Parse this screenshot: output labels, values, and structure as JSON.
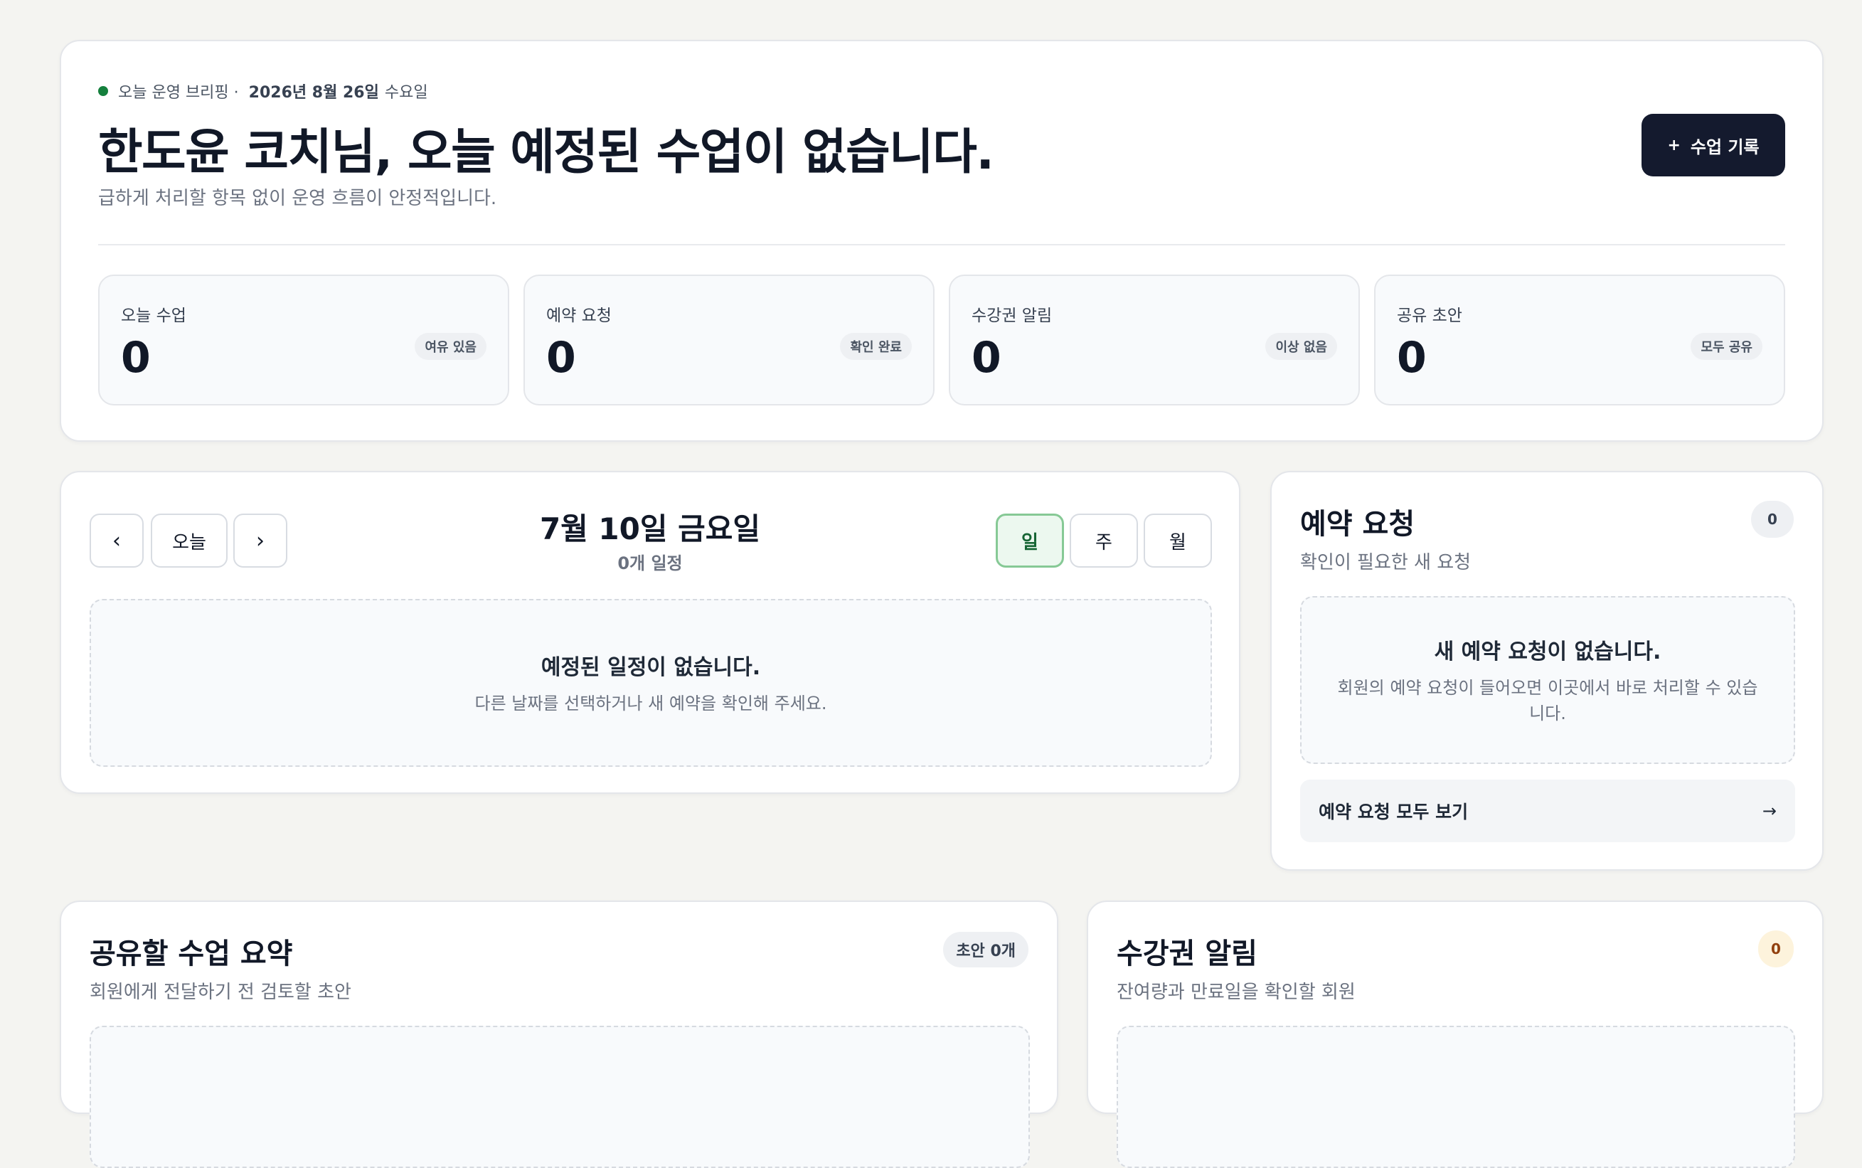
{
  "hero": {
    "eyebrow_label": "오늘 운영 브리핑 ·",
    "eyebrow_date": "2026년 8월 26일",
    "eyebrow_weekday": "수요일",
    "title": "한도윤 코치님, 오늘 예정된 수업이 없습니다.",
    "subtitle": "급하게 처리할 항목 없이 운영 흐름이 안정적입니다.",
    "primary_button": "수업 기록",
    "primary_button_icon": "+",
    "accent_color": "#15803d"
  },
  "stats": [
    {
      "label": "오늘 수업",
      "value": "0",
      "badge": "여유 있음"
    },
    {
      "label": "예약 요청",
      "value": "0",
      "badge": "확인 완료"
    },
    {
      "label": "수강권 알림",
      "value": "0",
      "badge": "이상 없음"
    },
    {
      "label": "공유 초안",
      "value": "0",
      "badge": "모두 공유"
    }
  ],
  "schedule": {
    "prev_label": "‹",
    "today_label": "오늘",
    "next_label": "›",
    "date_title": "7월 10일 금요일",
    "count_label": "0개 일정",
    "views": [
      {
        "label": "일",
        "active": true
      },
      {
        "label": "주",
        "active": false
      },
      {
        "label": "월",
        "active": false
      }
    ],
    "empty_title": "예정된 일정이 없습니다.",
    "empty_desc": "다른 날짜를 선택하거나 새 예약을 확인해 주세요."
  },
  "requests": {
    "title": "예약 요청",
    "subtitle": "확인이 필요한 새 요청",
    "count": "0",
    "empty_title": "새 예약 요청이 없습니다.",
    "empty_desc": "회원의 예약 요청이 들어오면 이곳에서 바로 처리할 수 있습니다.",
    "see_all": "예약 요청 모두 보기",
    "see_all_arrow": "→"
  },
  "summaries": {
    "title": "공유할 수업 요약",
    "subtitle": "회원에게 전달하기 전 검토할 초안",
    "badge": "초안 0개"
  },
  "alerts": {
    "title": "수강권 알림",
    "subtitle": "잔여량과 만료일을 확인할 회원",
    "count": "0"
  }
}
